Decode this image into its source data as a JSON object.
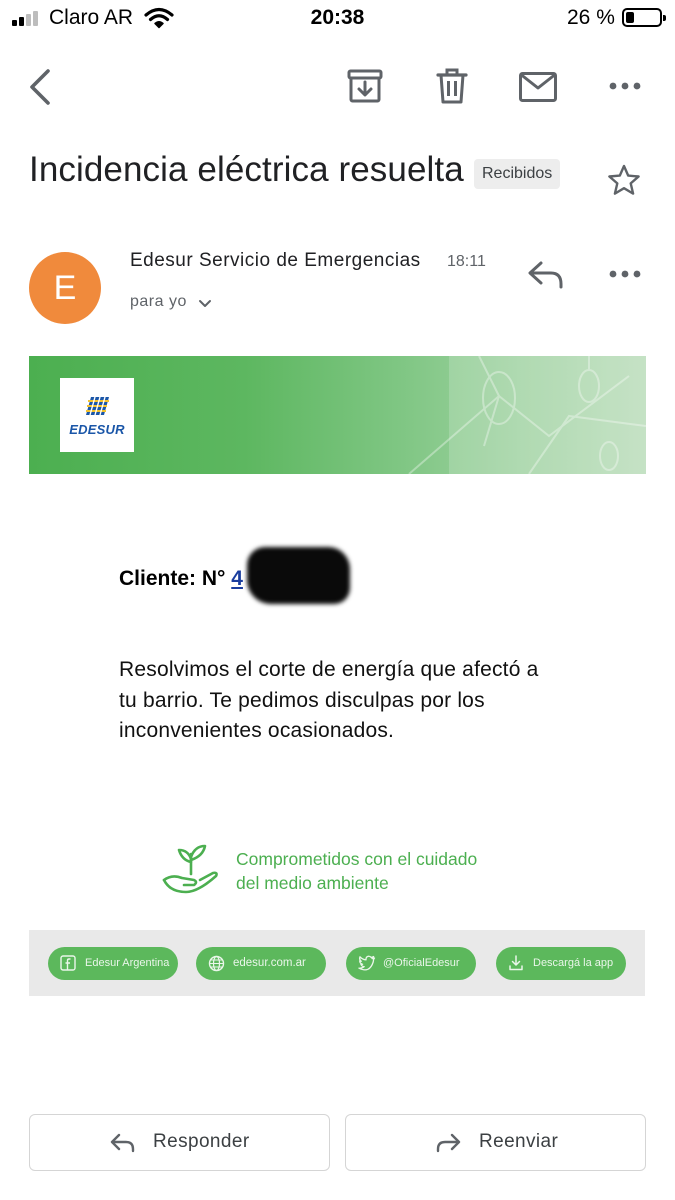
{
  "status_bar": {
    "carrier": "Claro AR",
    "time": "20:38",
    "battery_text": "26 %",
    "battery_level": 0.26
  },
  "toolbar": {
    "icons": [
      "back-arrow-icon",
      "archive-icon",
      "trash-icon",
      "mark-unread-icon",
      "more-icon"
    ]
  },
  "email": {
    "subject": "Incidencia eléctrica resuelta",
    "label": "Recibidos",
    "sender": {
      "avatar_letter": "E",
      "avatar_color": "#f08a3c",
      "name": "Edesur Servicio de Emergencias",
      "time": "18:11",
      "recipient": "para yo"
    },
    "body": {
      "logo_text": "EDESUR",
      "client_label": "Cliente: N°",
      "client_number": "4",
      "message": "Resolvimos el corte de energía que afectó a tu barrio. Te pedimos disculpas por los inconvenientes ocasionados.",
      "eco_line1": "Comprometidos con el cuidado",
      "eco_line2": "del medio ambiente",
      "social_links": [
        {
          "label": "Edesur Argentina",
          "icon": "facebook-icon"
        },
        {
          "label": "edesur.com.ar",
          "icon": "globe-icon"
        },
        {
          "label": "@OficialEdesur",
          "icon": "twitter-icon"
        },
        {
          "label": "Descargá la app",
          "icon": "download-icon"
        }
      ]
    }
  },
  "actions": {
    "reply_label": "Responder",
    "forward_label": "Reenviar"
  },
  "colors": {
    "brand_green": "#4caf50",
    "edesur_blue": "#1a56a8",
    "avatar_orange": "#f08a3c"
  }
}
